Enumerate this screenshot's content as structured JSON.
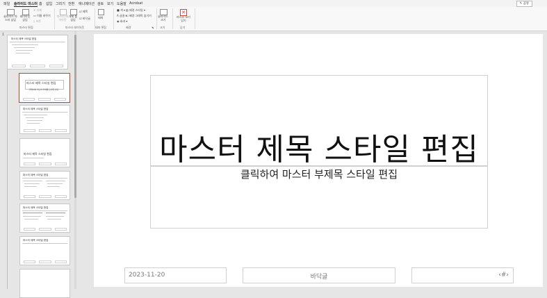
{
  "menu": {
    "tabs": [
      "파일",
      "슬라이드 마스터",
      "홈",
      "삽입",
      "그리기",
      "전환",
      "애니메이션",
      "검토",
      "보기",
      "도움말",
      "Acrobat"
    ],
    "active_tab": "슬라이드 마스터",
    "share_label": "공유"
  },
  "ribbon": {
    "insert_master": "슬라이드 마스터 삽입",
    "insert_layout": "레이아웃 삽입",
    "delete": "삭제",
    "rename": "이름 바꾸기",
    "preserve": "보존",
    "group_edit_master": "마스터 편집",
    "master_layout": "마스터 레이아웃",
    "insert_placeholder": "개체 틀 삽입",
    "title_check": "제목",
    "footer_check": "바닥글",
    "group_master_layout": "마스터 레이아웃",
    "themes": "테마",
    "group_edit_theme": "테마 편집",
    "colors": "색",
    "fonts": "글꼴",
    "effects": "효과",
    "background_styles": "배경 스타일",
    "hide_bg_graphics": "배경 그래픽 숨기기",
    "group_background": "배경",
    "slide_size": "슬라이드 크기",
    "group_size": "크기",
    "close_master": "마스터 보기 닫기",
    "group_close": "닫기"
  },
  "thumbnails": {
    "slide_number": "1",
    "master_title": "마스터 제목 스타일 편집",
    "layout_title": "마스터 제목 스타일 편집",
    "layout_subtitle": "클릭하여 마스터 부제목 스타일 편집"
  },
  "slide": {
    "title": "마스터 제목 스타일 편집",
    "subtitle": "클릭하여 마스터 부제목 스타일 편집",
    "date": "2023-11-20",
    "footer": "바닥글",
    "slide_number": "‹#›"
  }
}
